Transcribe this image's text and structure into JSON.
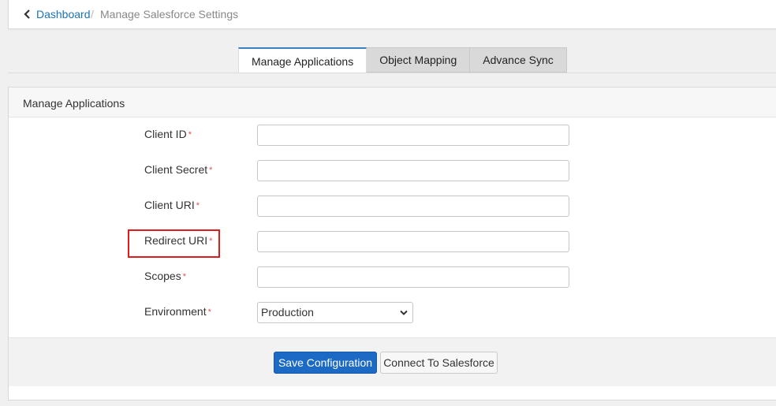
{
  "breadcrumb": {
    "back_icon": "chevron-left-icon",
    "link": "Dashboard",
    "separator": "/",
    "current": "Manage Salesforce Settings"
  },
  "tabs": [
    {
      "label": "Manage Applications",
      "active": true
    },
    {
      "label": "Object Mapping",
      "active": false
    },
    {
      "label": "Advance Sync",
      "active": false
    }
  ],
  "panel": {
    "title": "Manage Applications",
    "fields": [
      {
        "label": "Client ID",
        "required": "*",
        "value": ""
      },
      {
        "label": "Client Secret",
        "required": "*",
        "value": ""
      },
      {
        "label": "Client URI",
        "required": "*",
        "value": ""
      },
      {
        "label": "Redirect URI",
        "required": "*",
        "value": ""
      },
      {
        "label": "Scopes",
        "required": "*",
        "value": ""
      }
    ],
    "environment": {
      "label": "Environment",
      "required": "*",
      "value": "Production",
      "icon": "chevron-down-icon"
    },
    "highlight_color": "#e01b1b"
  },
  "buttons": {
    "save": "Save Configuration",
    "connect": "Connect To Salesforce"
  },
  "colors": {
    "accent": "#1c6ac4",
    "link": "#1a73b8",
    "required": "#d9534f"
  }
}
